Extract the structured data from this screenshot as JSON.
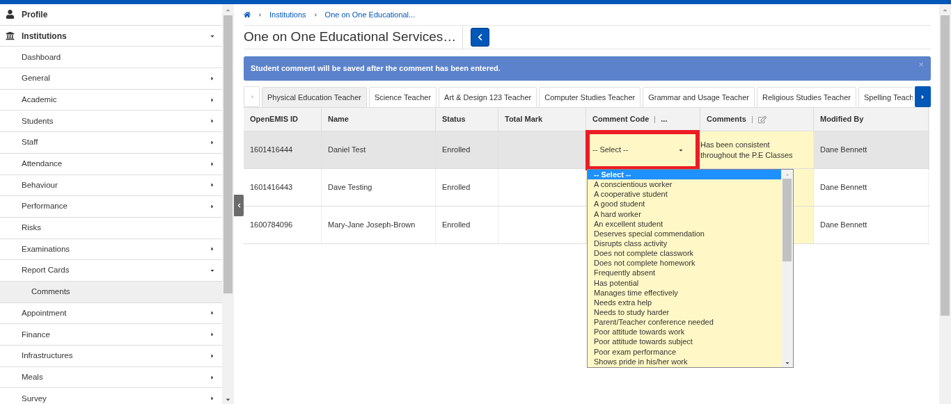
{
  "sidebar": {
    "items": [
      {
        "label": "Profile",
        "kind": "user",
        "selected": false
      },
      {
        "label": "Institutions",
        "kind": "institution",
        "selected": false,
        "expanded": true,
        "children": [
          {
            "label": "Dashboard",
            "selected": false
          },
          {
            "label": "General",
            "selected": false,
            "expanded": false
          },
          {
            "label": "Academic",
            "selected": false,
            "expanded": false
          },
          {
            "label": "Students",
            "selected": false,
            "expanded": false
          },
          {
            "label": "Staff",
            "selected": false,
            "expanded": false
          },
          {
            "label": "Attendance",
            "selected": false,
            "expanded": false
          },
          {
            "label": "Behaviour",
            "selected": false,
            "expanded": false
          },
          {
            "label": "Performance",
            "selected": false,
            "expanded": false
          },
          {
            "label": "Risks",
            "selected": false
          },
          {
            "label": "Examinations",
            "selected": false,
            "expanded": false
          },
          {
            "label": "Report Cards",
            "selected": false,
            "expanded": true,
            "children": [
              {
                "label": "Comments",
                "selected": true
              }
            ]
          },
          {
            "label": "Appointment",
            "selected": false,
            "expanded": false
          },
          {
            "label": "Finance",
            "selected": false,
            "expanded": false
          },
          {
            "label": "Infrastructures",
            "selected": false,
            "expanded": false
          },
          {
            "label": "Meals",
            "selected": false,
            "expanded": false
          },
          {
            "label": "Survey",
            "selected": false,
            "expanded": false
          }
        ]
      }
    ]
  },
  "breadcrumb": [
    "Institutions",
    "One on One Educational..."
  ],
  "page_title": "One on One Educational Services…",
  "alert": {
    "message": "Student comment will be saved after the comment has been entered.",
    "close": "×"
  },
  "tabs": [
    {
      "label": "Physical Education Teacher",
      "selected": true
    },
    {
      "label": "Science Teacher",
      "selected": false
    },
    {
      "label": "Art & Design 123 Teacher",
      "selected": false
    },
    {
      "label": "Computer Studies Teacher",
      "selected": false
    },
    {
      "label": "Grammar and Usage Teacher",
      "selected": false
    },
    {
      "label": "Religious Studies Teacher",
      "selected": false
    },
    {
      "label": "Spelling Teach",
      "selected": false
    }
  ],
  "table": {
    "columns": [
      {
        "label": "OpenEMIS ID"
      },
      {
        "label": "Name"
      },
      {
        "label": "Status"
      },
      {
        "label": "Total Mark"
      },
      {
        "label": "Comment Code",
        "kind": "menu",
        "extra": "..."
      },
      {
        "label": "Comments",
        "kind": "edit"
      },
      {
        "label": "Modified By"
      }
    ],
    "rows": [
      {
        "selected": true,
        "cells": [
          "1601416444",
          "Daniel Test",
          "Enrolled",
          "",
          "-- Select --",
          "Has been consistent throughout the P.E Classes",
          "Dane Bennett"
        ]
      },
      {
        "selected": false,
        "cells": [
          "1601416443",
          "Dave Testing",
          "Enrolled",
          "",
          "",
          "",
          "Dane Bennett"
        ]
      },
      {
        "selected": false,
        "cells": [
          "1600784096",
          "Mary-Jane Joseph-Brown",
          "Enrolled",
          "",
          "",
          "",
          "Dane Bennett"
        ]
      }
    ]
  },
  "dropdown": {
    "expanded": true,
    "options": [
      {
        "label": "-- Select --",
        "selected": true
      },
      {
        "label": "A conscientious worker",
        "selected": false
      },
      {
        "label": "A cooperative student",
        "selected": false
      },
      {
        "label": "A good student",
        "selected": false
      },
      {
        "label": "A hard worker",
        "selected": false
      },
      {
        "label": "An excellent student",
        "selected": false
      },
      {
        "label": "Deserves special commendation",
        "selected": false
      },
      {
        "label": "Disrupts class activity",
        "selected": false
      },
      {
        "label": "Does not complete classwork",
        "selected": false
      },
      {
        "label": "Does not complete homework",
        "selected": false
      },
      {
        "label": "Frequently absent",
        "selected": false
      },
      {
        "label": "Has potential",
        "selected": false
      },
      {
        "label": "Manages time effectively",
        "selected": false
      },
      {
        "label": "Needs extra help",
        "selected": false
      },
      {
        "label": "Needs to study harder",
        "selected": false
      },
      {
        "label": "Parent/Teacher conference needed",
        "selected": false
      },
      {
        "label": "Poor attitude towards work",
        "selected": false
      },
      {
        "label": "Poor attitude towards subject",
        "selected": false
      },
      {
        "label": "Poor exam performance",
        "selected": false
      },
      {
        "label": "Shows pride in his/her work",
        "selected": false
      }
    ]
  }
}
